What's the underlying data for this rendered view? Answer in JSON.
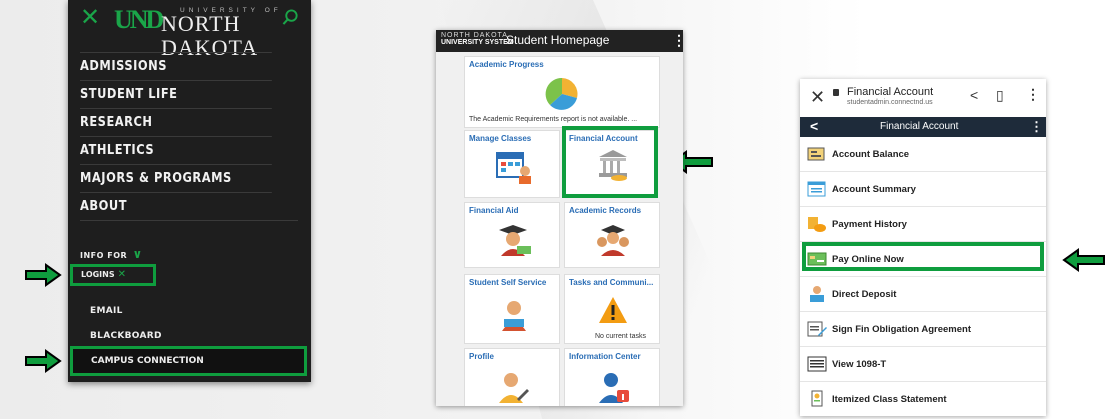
{
  "panel1": {
    "logo_und": "UND",
    "logo_small": "UNIVERSITY OF",
    "logo_big": "NORTH DAKOTA",
    "menu": [
      "ADMISSIONS",
      "STUDENT LIFE",
      "RESEARCH",
      "ATHLETICS",
      "MAJORS & PROGRAMS",
      "ABOUT"
    ],
    "info_for": "INFO FOR",
    "logins": "LOGINS",
    "email": "EMAIL",
    "blackboard": "BLACKBOARD",
    "campus_connection": "CAMPUS CONNECTION"
  },
  "panel2": {
    "sys_line1": "NORTH DAKOTA",
    "sys_line2": "UNIVERSITY SYSTEM",
    "title": "Student Homepage",
    "tiles": {
      "academic_progress": "Academic Progress",
      "academic_progress_note": "The Academic Requirements report is not available. ...",
      "manage_classes": "Manage Classes",
      "financial_account": "Financial Account",
      "financial_aid": "Financial Aid",
      "academic_records": "Academic Records",
      "student_self_service": "Student Self Service",
      "tasks": "Tasks and Communi...",
      "tasks_note": "No current tasks",
      "profile": "Profile",
      "information_center": "Information Center"
    }
  },
  "panel3": {
    "browser_title": "Financial Account",
    "browser_url": "studentadmin.connectnd.us",
    "nav_title": "Financial Account",
    "items": [
      "Account Balance",
      "Account Summary",
      "Payment History",
      "Pay Online Now",
      "Direct Deposit",
      "Sign Fin Obligation Agreement",
      "View 1098-T",
      "Itemized Class Statement"
    ]
  },
  "colors": {
    "highlight": "#0f9d3e",
    "und_green": "#1aa549",
    "dark": "#1e1e1e",
    "link_blue": "#2a6db5"
  }
}
